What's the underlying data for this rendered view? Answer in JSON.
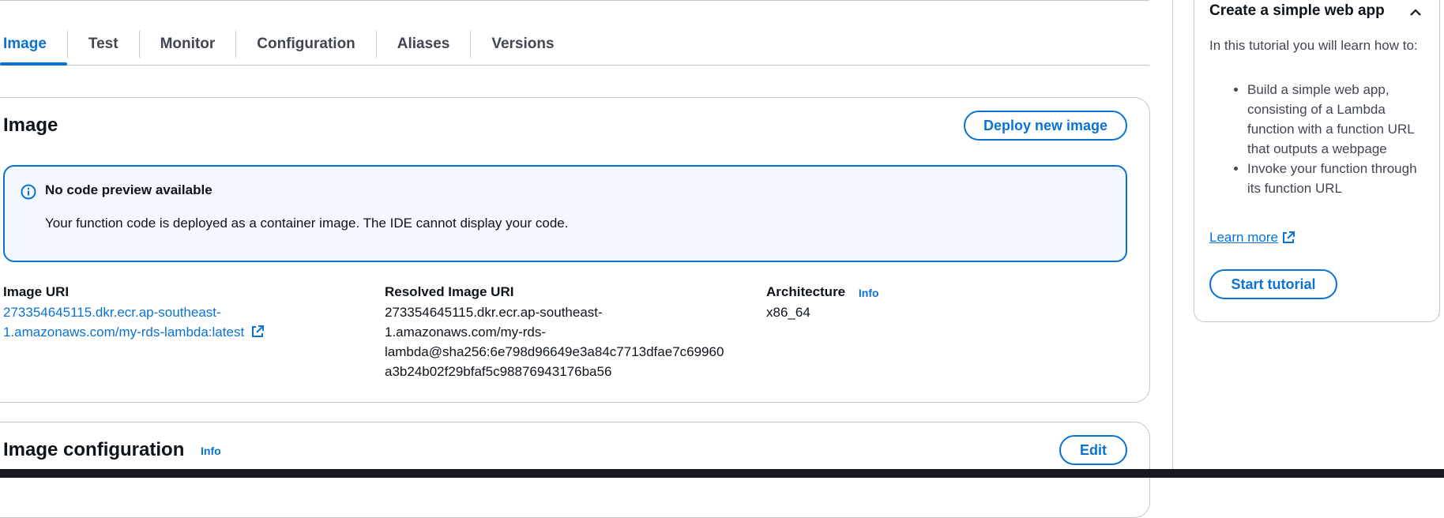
{
  "tabs": [
    {
      "label": "Image",
      "active": true
    },
    {
      "label": "Test"
    },
    {
      "label": "Monitor"
    },
    {
      "label": "Configuration"
    },
    {
      "label": "Aliases"
    },
    {
      "label": "Versions"
    }
  ],
  "image_section": {
    "title": "Image",
    "deploy_button": "Deploy new image",
    "alert": {
      "title": "No code preview available",
      "body": "Your function code is deployed as a container image. The IDE cannot display your code."
    },
    "image_uri": {
      "label": "Image URI",
      "value_line1": "273354645115.dkr.ecr.ap-southeast-",
      "value_line2": "1.amazonaws.com/my-rds-lambda:latest"
    },
    "resolved_uri": {
      "label": "Resolved Image URI",
      "lines": [
        "273354645115.dkr.ecr.ap-southeast-",
        "1.amazonaws.com/my-rds-",
        "lambda@sha256:6e798d96649e3a84c7713dfae7c69960",
        "a3b24b02f29bfaf5c98876943176ba56"
      ]
    },
    "architecture": {
      "label": "Architecture",
      "info": "Info",
      "value": "x86_64"
    }
  },
  "image_config": {
    "title": "Image configuration",
    "info": "Info",
    "edit_button": "Edit"
  },
  "tutorial": {
    "title": "Create a simple web app",
    "intro": "In this tutorial you will learn how to:",
    "items": [
      "Build a simple web app, consisting of a Lambda function with a function URL that outputs a webpage",
      "Invoke your function through its function URL"
    ],
    "learn_more": "Learn more",
    "start_button": "Start tutorial"
  },
  "colors": {
    "accent": "#0972d3",
    "alert_bg": "#f2f8fd",
    "border": "#c6c6cd",
    "bottom_bar": "#16191f"
  }
}
